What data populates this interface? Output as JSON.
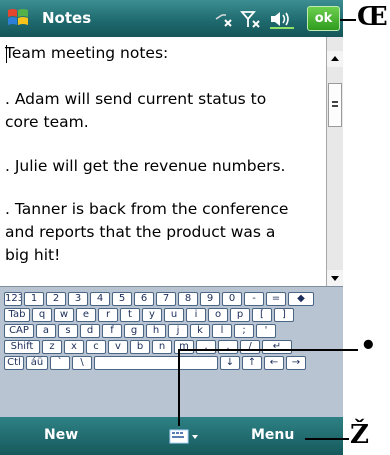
{
  "titlebar": {
    "title": "Notes",
    "ok_label": "ok"
  },
  "notes": {
    "lines": [
      "Team meeting notes:",
      ". Adam will send current  status to",
      "core team.",
      ". Julie will get the revenue numbers.",
      ". Tanner is back from the conference",
      "and reports that the product was a",
      "big hit!"
    ]
  },
  "keyboard": {
    "rows": [
      [
        "123",
        "1",
        "2",
        "3",
        "4",
        "5",
        "6",
        "7",
        "8",
        "9",
        "0",
        "-",
        "=",
        "◆"
      ],
      [
        "Tab",
        "q",
        "w",
        "e",
        "r",
        "t",
        "y",
        "u",
        "i",
        "o",
        "p",
        "[",
        "]"
      ],
      [
        "CAP",
        "a",
        "s",
        "d",
        "f",
        "g",
        "h",
        "j",
        "k",
        "l",
        ";",
        "'"
      ],
      [
        "Shift",
        "z",
        "x",
        "c",
        "v",
        "b",
        "n",
        "m",
        ",",
        ".",
        "/",
        "↵"
      ],
      [
        "Ctl",
        "áü",
        "`",
        "\\",
        " ",
        "↓",
        "↑",
        "←",
        "→"
      ]
    ]
  },
  "bottombar": {
    "new_label": "New",
    "menu_label": "Menu"
  },
  "callouts": {
    "top": "Œ",
    "middle": "•",
    "bottom": "Ž"
  },
  "colors": {
    "titlebar": "#1f6b6f",
    "ok": "#3aa526",
    "keyboard_bg": "#b8c4d2",
    "key_border": "#4b6584"
  }
}
